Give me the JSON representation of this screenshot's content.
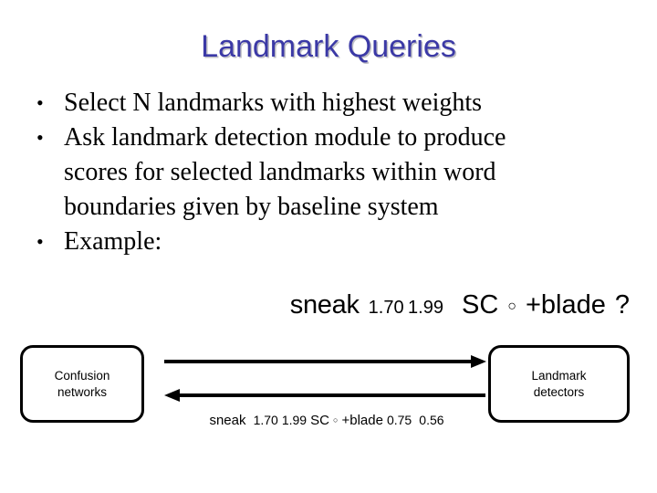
{
  "slide": {
    "title": "Landmark Queries",
    "title_color": "#3b39a6",
    "background": "#ffffff"
  },
  "bullets": [
    {
      "marker": "•",
      "lines": [
        "Select N landmarks with highest weights"
      ]
    },
    {
      "marker": "•",
      "lines": [
        "Ask landmark detection module to produce",
        "scores for selected landmarks within word",
        "boundaries given by baseline system"
      ]
    },
    {
      "marker": "•",
      "lines": [
        "Example:"
      ]
    }
  ],
  "example_line": {
    "word": "sneak",
    "score1": "1.70",
    "score2": "1.99",
    "tag": "SC",
    "circle": "○",
    "plus_word": "+blade",
    "query": "?"
  },
  "diagram": {
    "left_box": {
      "line1": "Confusion",
      "line2": "networks"
    },
    "right_box": {
      "line1": "Landmark",
      "line2": "detectors"
    },
    "arrow_forward": "→",
    "arrow_back": "←",
    "result_line": {
      "word": "sneak",
      "score1": "1.70",
      "score2": "1.99",
      "tag": "SC",
      "circle": "○",
      "plus_word": "+blade",
      "score3": "0.75",
      "score4": "0.56"
    }
  }
}
